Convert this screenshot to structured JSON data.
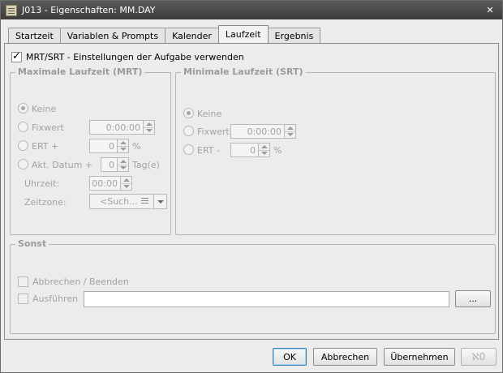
{
  "window": {
    "title": "J013 - Eigenschaften: MM.DAY",
    "close_glyph": "✕",
    "app_icon": "document-properties-icon"
  },
  "tabs": [
    {
      "label": "Startzeit",
      "active": false
    },
    {
      "label": "Variablen & Prompts",
      "active": false
    },
    {
      "label": "Kalender",
      "active": false
    },
    {
      "label": "Laufzeit",
      "active": true
    },
    {
      "label": "Ergebnis",
      "active": false
    }
  ],
  "mrt_srt": {
    "checkbox_label": "MRT/SRT - Einstellungen der Aufgabe verwenden",
    "checked": true
  },
  "mrt": {
    "title": "Maximale Laufzeit (MRT)",
    "options": {
      "keine": "Keine",
      "fixwert": "Fixwert",
      "ert": "ERT +",
      "akt_datum": "Akt. Datum +"
    },
    "selected": "keine",
    "fixwert_value": "0:00:00",
    "ert_value": "0",
    "ert_unit": "%",
    "akt_datum_value": "0",
    "akt_datum_unit": "Tag(e)",
    "uhrzeit_label": "Uhrzeit:",
    "uhrzeit_value": "00:00",
    "zeitzone_label": "Zeitzone:",
    "zeitzone_placeholder": "<Such..."
  },
  "srt": {
    "title": "Minimale Laufzeit (SRT)",
    "options": {
      "keine": "Keine",
      "fixwert": "Fixwert",
      "ert": "ERT -"
    },
    "selected": "keine",
    "fixwert_value": "0:00:00",
    "ert_value": "0",
    "ert_unit": "%"
  },
  "sonst": {
    "title": "Sonst",
    "abbrechen_label": "Abbrechen / Beenden",
    "ausfuehren_label": "Ausführen",
    "ausfuehren_value": "",
    "browse_label": "..."
  },
  "buttons": {
    "ok": "OK",
    "abbrechen": "Abbrechen",
    "uebernehmen": "Übernehmen",
    "help_glyph": "ℵ0"
  }
}
